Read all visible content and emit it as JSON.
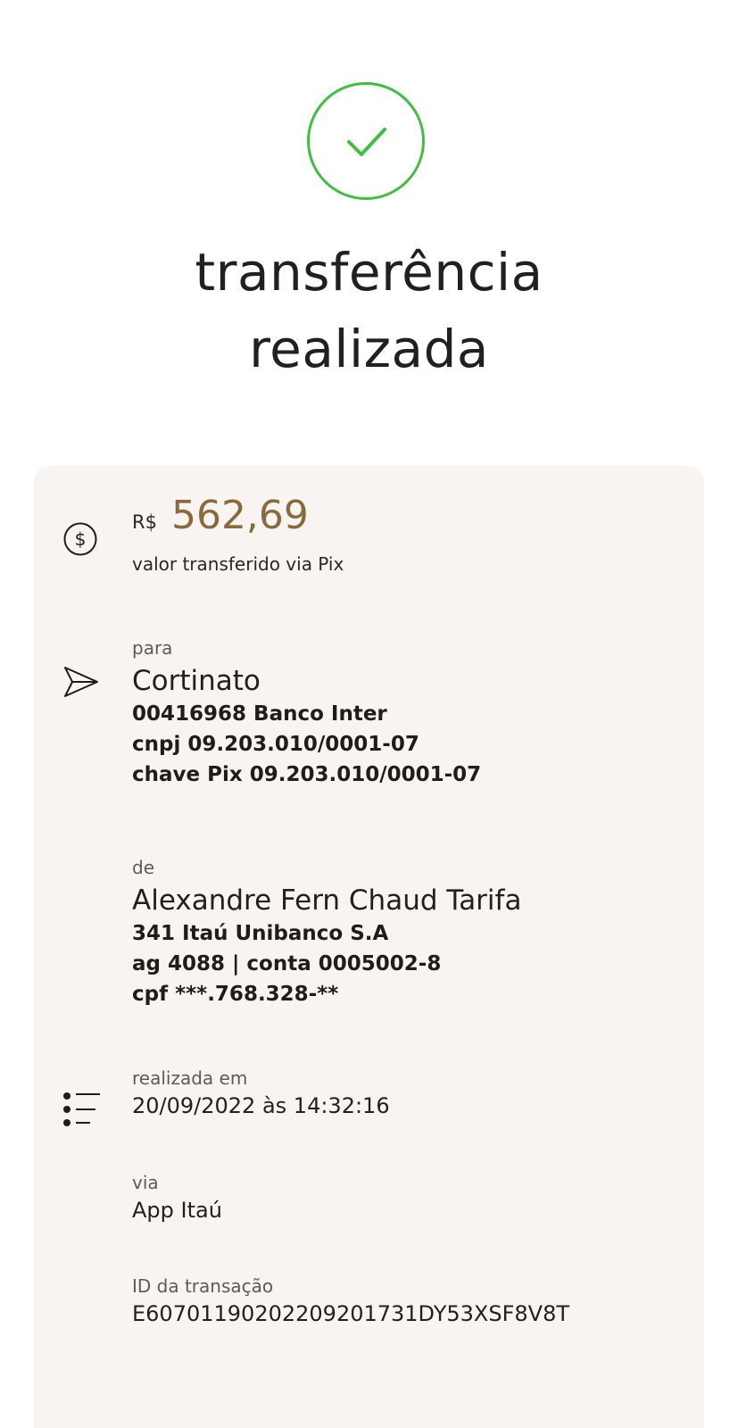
{
  "header": {
    "status_icon": "check-circle-icon",
    "status_color": "#3fbf3f",
    "title_line1": "transferência",
    "title_line2": "realizada"
  },
  "card": {
    "background": "#f8f4f1",
    "amount": {
      "icon": "dollar-circle-icon",
      "currency": "R$",
      "value": "562,69",
      "value_color": "#8a6a3c",
      "caption": "valor transferido via Pix"
    },
    "recipient": {
      "icon": "send-icon",
      "label": "para",
      "name": "Cortinato",
      "bank": "00416968 Banco Inter",
      "document": "cnpj 09.203.010/0001-07",
      "pix_key": "chave Pix 09.203.010/0001-07"
    },
    "sender": {
      "label": "de",
      "name": "Alexandre Fern Chaud Tarifa",
      "bank": "341 Itaú Unibanco S.A",
      "account": "ag 4088 | conta 0005002-8",
      "document": "cpf ***.768.328-**"
    },
    "details": {
      "icon": "list-icon",
      "date_label": "realizada em",
      "date_value": "20/09/2022 às 14:32:16",
      "channel_label": "via",
      "channel_value": "App Itaú",
      "transaction_id_label": "ID da transação",
      "transaction_id_value": "E60701190202209201731DY53XSF8V8T"
    }
  }
}
